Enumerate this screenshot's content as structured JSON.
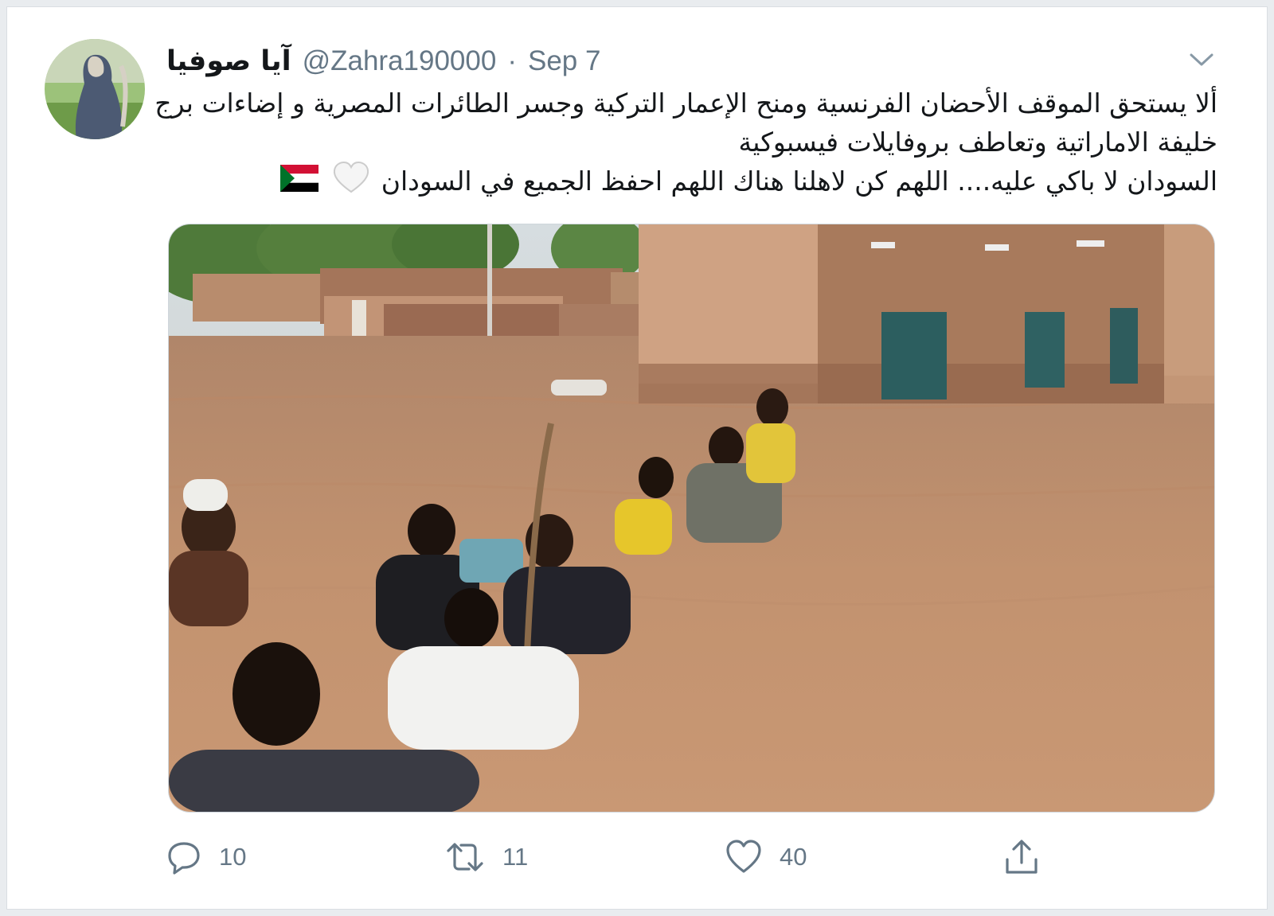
{
  "tweet": {
    "display_name": "آيا صوفيا",
    "handle": "@Zahra190000",
    "separator": "·",
    "date": "Sep 7",
    "text_lines": [
      "ألا يستحق الموقف الأحضان الفرنسية ومنح الإعمار التركية وجسر الطائرات المصرية و إضاءات برج",
      "خليفة الاماراتية وتعاطف بروفايلات فيسبوكية",
      "السودان لا باكي عليه.... اللهم كن لاهلنا هناك اللهم احفظ الجميع في السودان"
    ],
    "emojis": [
      "white-heart-icon",
      "sudan-flag-icon"
    ],
    "media_alt": "",
    "actions": {
      "reply_count": "10",
      "retweet_count": "11",
      "like_count": "40"
    }
  },
  "colors": {
    "secondary_text": "#657786",
    "primary_text": "#14171a",
    "card_border": "#d9dee2"
  }
}
